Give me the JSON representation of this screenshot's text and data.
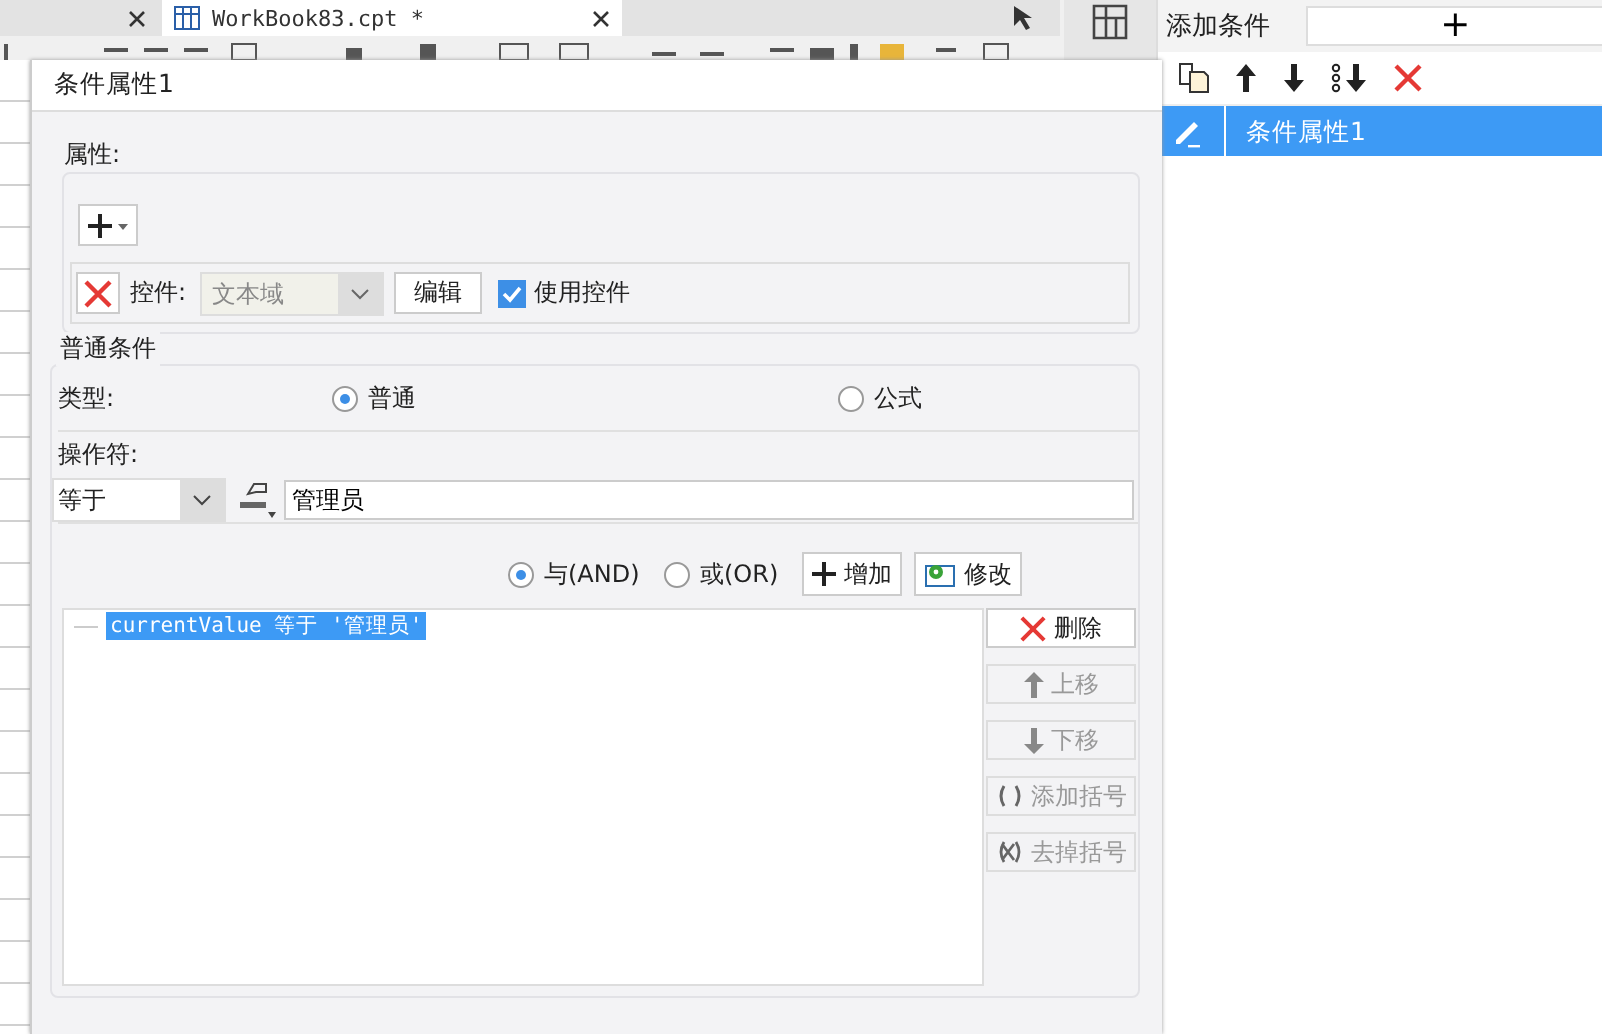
{
  "editor": {
    "tabs": [
      {
        "label": "WorkBook83.cpt *",
        "selected": true
      }
    ]
  },
  "right_panel": {
    "title": "添加条件",
    "add_button": "+",
    "items": [
      {
        "label": "条件属性1",
        "selected": true
      }
    ]
  },
  "dialog": {
    "title": "条件属性1",
    "properties": {
      "legend": "属性:",
      "control_label": "控件:",
      "control_value": "文本域",
      "control_disabled": true,
      "edit_button": "编辑",
      "use_control": {
        "label": "使用控件",
        "checked": true
      }
    },
    "conditions": {
      "legend": "普通条件",
      "type_label": "类型:",
      "types": [
        {
          "label": "普通",
          "selected": true
        },
        {
          "label": "公式",
          "selected": false
        }
      ],
      "operator_label": "操作符:",
      "operator": "等于",
      "value": "管理员",
      "logic": [
        {
          "label": "与(AND)",
          "selected": true
        },
        {
          "label": "或(OR)",
          "selected": false
        }
      ],
      "add_button": "增加",
      "modify_button": "修改",
      "list": [
        {
          "text": "currentValue 等于 '管理员'",
          "selected": true
        }
      ],
      "side_buttons": [
        {
          "kind": "delete",
          "label": "删除",
          "disabled": false
        },
        {
          "kind": "up",
          "label": "上移",
          "disabled": true
        },
        {
          "kind": "down",
          "label": "下移",
          "disabled": true
        },
        {
          "kind": "paren",
          "label": "添加括号",
          "disabled": true
        },
        {
          "kind": "unparen",
          "label": "去掉括号",
          "disabled": true
        }
      ]
    }
  }
}
